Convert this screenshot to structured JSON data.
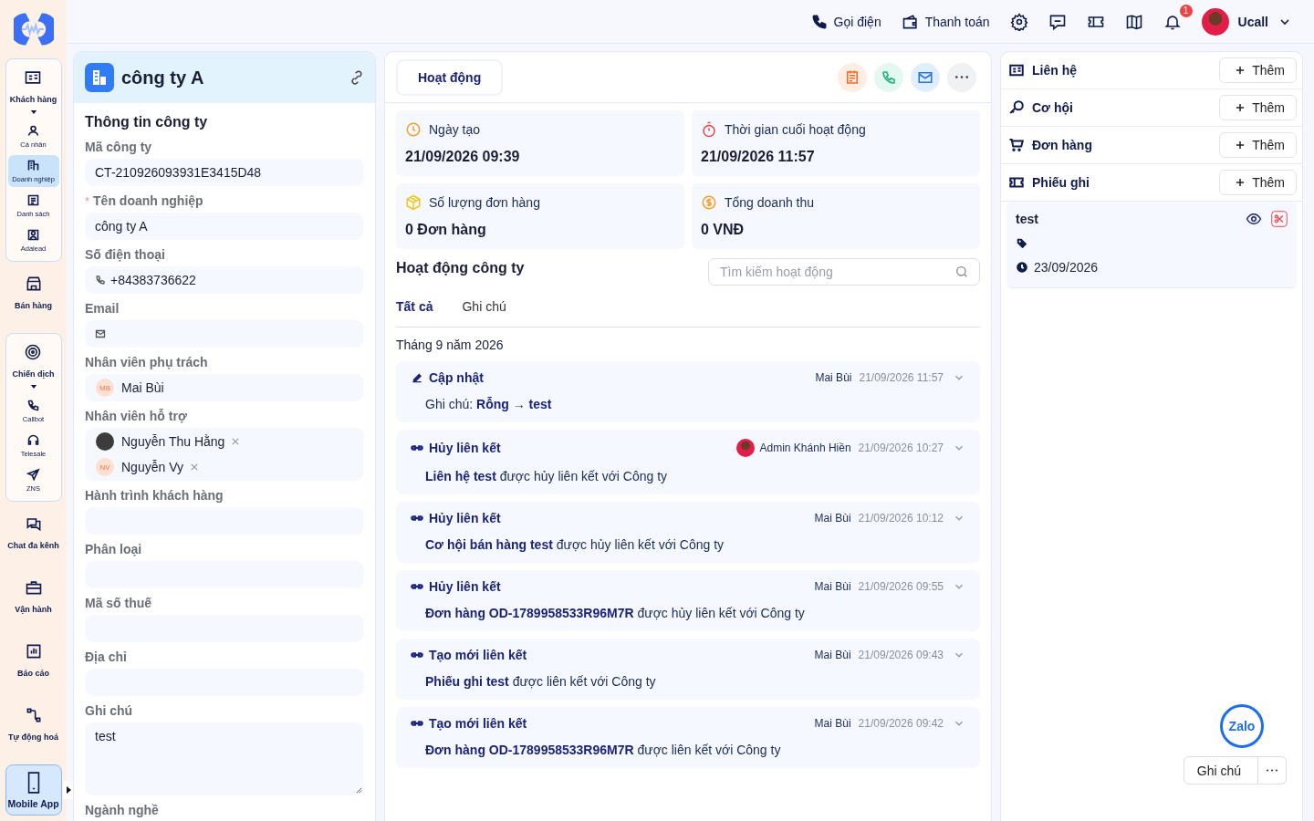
{
  "sidebar": {
    "items": [
      {
        "kind": "group",
        "label": "Khách hàng",
        "expanded": true,
        "selected": false,
        "children": [
          {
            "label": "Cá nhân",
            "selected": false
          },
          {
            "label": "Doanh nghiệp",
            "selected": true
          },
          {
            "label": "Danh sách",
            "selected": false
          },
          {
            "label": "Adalead",
            "selected": false
          }
        ]
      },
      {
        "kind": "item",
        "label": "Bán hàng",
        "selected": false
      },
      {
        "kind": "group",
        "label": "Chiến dịch",
        "expanded": true,
        "selected": false,
        "children": [
          {
            "label": "Callbot",
            "selected": false
          },
          {
            "label": "Telesale",
            "selected": false
          },
          {
            "label": "ZNS",
            "selected": false
          }
        ]
      },
      {
        "kind": "item",
        "label": "Chat đa kênh",
        "selected": false
      },
      {
        "kind": "item",
        "label": "Vận hành",
        "selected": false
      },
      {
        "kind": "item",
        "label": "Báo cáo",
        "selected": false
      },
      {
        "kind": "item",
        "label": "Tự động hoá",
        "selected": false
      },
      {
        "kind": "promo",
        "label": "Mobile App",
        "selected": false
      }
    ]
  },
  "topbar": {
    "actions": [
      {
        "kind": "call",
        "label": "Gọi điện"
      },
      {
        "kind": "payment",
        "label": "Thanh toán"
      }
    ],
    "notification_count": "1",
    "user": "Ucall"
  },
  "company": {
    "title": "công ty A",
    "section": "Thông tin công ty",
    "fields": [
      {
        "kind": "text",
        "label": "Mã công ty",
        "value": "CT-210926093931E3415D48"
      },
      {
        "kind": "text",
        "label": "Tên doanh nghiệp",
        "required_mark": "*",
        "value": "công ty A"
      },
      {
        "kind": "phone",
        "label": "Số điện thoại",
        "value": "+84383736622"
      },
      {
        "kind": "email",
        "label": "Email"
      },
      {
        "kind": "people",
        "label": "Nhân viên phụ trách",
        "people": [
          {
            "name": "Mai Bùi",
            "initials": "MB",
            "removable": false
          }
        ]
      },
      {
        "kind": "people",
        "label": "Nhân viên hỗ trợ",
        "people": [
          {
            "name": "Nguyễn Thu Hằng",
            "removable": true
          },
          {
            "name": "Nguyễn Vy",
            "initials": "NV",
            "removable": true
          }
        ]
      },
      {
        "kind": "text",
        "label": "Hành trình khách hàng"
      },
      {
        "kind": "text",
        "label": "Phân loại"
      },
      {
        "kind": "text",
        "label": "Mã số thuế"
      },
      {
        "kind": "text",
        "label": "Địa chỉ"
      },
      {
        "kind": "textarea",
        "label": "Ghi chú",
        "value": "test"
      },
      {
        "kind": "label",
        "label": "Ngành nghề"
      }
    ]
  },
  "activity": {
    "tab": {
      "label": "Hoạt động",
      "selected": true
    },
    "stats": [
      {
        "kind": "created",
        "label": "Ngày tạo",
        "value": "21/09/2026 09:39"
      },
      {
        "kind": "last",
        "label": "Thời gian cuối hoạt động",
        "value": "21/09/2026 11:57"
      },
      {
        "kind": "orders",
        "label": "Số lượng đơn hàng",
        "value": "0 Đơn hàng"
      },
      {
        "kind": "revenue",
        "label": "Tổng doanh thu",
        "value": "0 VNĐ"
      }
    ],
    "section": "Hoạt động công ty",
    "search": {
      "placeholder": "Tìm kiếm hoạt động"
    },
    "filters": [
      {
        "label": "Tất cả",
        "selected": true
      },
      {
        "label": "Ghi chú",
        "selected": false
      }
    ],
    "month": "Tháng 9 năm 2026",
    "items": [
      {
        "kind": "update",
        "title": "Cập nhật",
        "user": "Mai Bùi",
        "photo": false,
        "time": "21/09/2026 11:57",
        "text": "Ghi chú: **Rỗng** → **test**"
      },
      {
        "kind": "unlink",
        "title": "Hủy liên kết",
        "user": "Admin Khánh Hiền",
        "photo": true,
        "time": "21/09/2026 10:27",
        "text": "**Liên hệ test** được hủy liên kết với Công ty"
      },
      {
        "kind": "unlink",
        "title": "Hủy liên kết",
        "user": "Mai Bùi",
        "photo": false,
        "time": "21/09/2026 10:12",
        "text": "**Cơ hội bán hàng test** được hủy liên kết với Công ty"
      },
      {
        "kind": "unlink",
        "title": "Hủy liên kết",
        "user": "Mai Bùi",
        "photo": false,
        "time": "21/09/2026 09:55",
        "text": "**Đơn hàng OD-1789958533R96M7R** được hủy liên kết với Công ty"
      },
      {
        "kind": "link",
        "title": "Tạo mới liên kết",
        "user": "Mai Bùi",
        "photo": false,
        "time": "21/09/2026 09:43",
        "text": "**Phiếu ghi test** được liên kết với Công ty"
      },
      {
        "kind": "link",
        "title": "Tạo mới liên kết",
        "user": "Mai Bùi",
        "photo": false,
        "time": "21/09/2026 09:42",
        "text": "**Đơn hàng OD-1789958533R96M7R** được liên kết với Công ty"
      }
    ]
  },
  "related": {
    "sections": [
      {
        "kind": "contact",
        "label": "Liên hệ",
        "button": "Thêm"
      },
      {
        "kind": "opportunity",
        "label": "Cơ hội",
        "button": "Thêm"
      },
      {
        "kind": "order",
        "label": "Đơn hàng",
        "button": "Thêm"
      },
      {
        "kind": "ticket",
        "label": "Phiếu ghi",
        "button": "Thêm"
      }
    ],
    "note": {
      "title": "test",
      "date": "23/09/2026"
    }
  },
  "widget": {
    "note_button": "Ghi chú",
    "chat": "Zalo"
  }
}
